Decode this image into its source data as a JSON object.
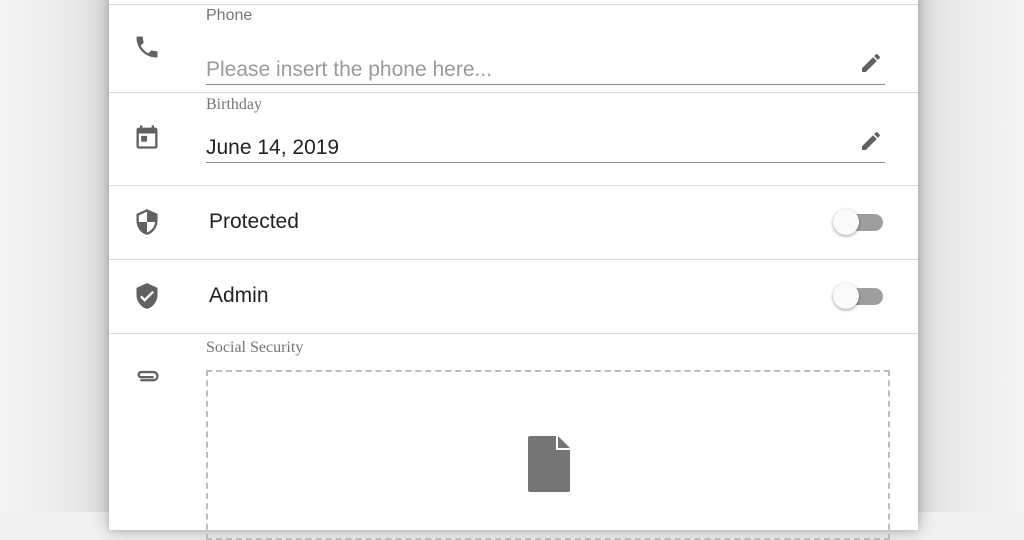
{
  "form": {
    "phone": {
      "label": "Phone",
      "placeholder": "Please insert the phone here...",
      "value": "",
      "icon": "phone-icon"
    },
    "birthday": {
      "label": "Birthday",
      "value": "June 14, 2019",
      "icon": "calendar-icon"
    },
    "protected": {
      "label": "Protected",
      "checked": false,
      "icon": "shield-half-icon"
    },
    "admin": {
      "label": "Admin",
      "checked": false,
      "icon": "verified-shield-icon"
    },
    "social_security": {
      "label": "Social Security",
      "icon": "attachment-icon",
      "dropzone_icon": "file-icon"
    }
  },
  "colors": {
    "icon": "#616161",
    "file_icon": "#757575",
    "toggle_track": "#9e9e9e",
    "toggle_thumb": "#fafafa",
    "divider": "#dcdcdc"
  }
}
